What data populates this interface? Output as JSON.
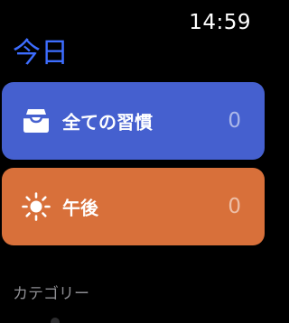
{
  "status": {
    "time": "14:59"
  },
  "header": {
    "title": "今日"
  },
  "cards": [
    {
      "label": "全ての習慣",
      "count": "0",
      "icon": "inbox-tray-icon",
      "color": "#4560cf"
    },
    {
      "label": "午後",
      "count": "0",
      "icon": "sun-icon",
      "color": "#d8703a"
    }
  ],
  "section": {
    "label": "カテゴリー"
  },
  "colors": {
    "background": "#000000",
    "title_accent": "#3d6dff",
    "secondary_text": "#8e8e93"
  }
}
